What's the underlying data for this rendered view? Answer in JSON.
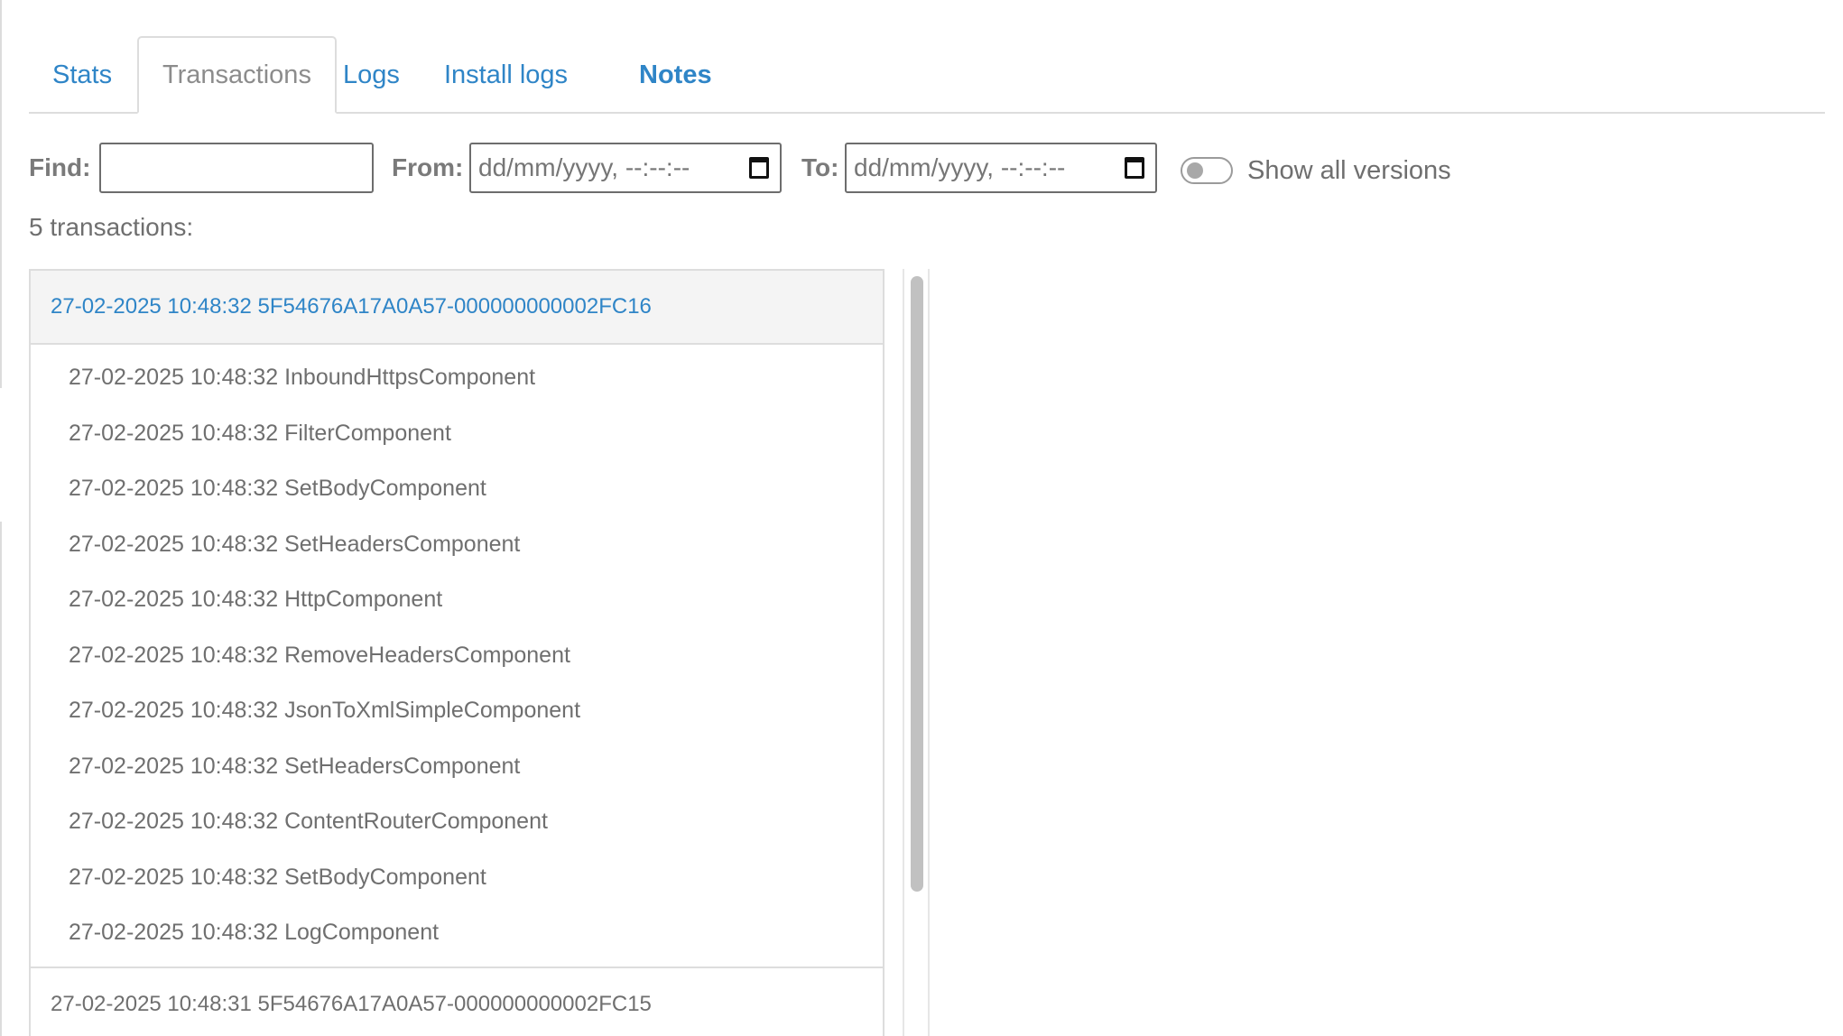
{
  "tabs": [
    {
      "label": "Stats",
      "active": false,
      "bold": false
    },
    {
      "label": "Transactions",
      "active": true,
      "bold": false
    },
    {
      "label": "Logs",
      "active": false,
      "bold": false
    },
    {
      "label": "Install logs",
      "active": false,
      "bold": false
    },
    {
      "label": "Notes",
      "active": false,
      "bold": true
    }
  ],
  "filters": {
    "find_label": "Find:",
    "find_value": "",
    "from_label": "From:",
    "from_placeholder": "dd/mm/yyyy, --:--:--",
    "to_label": "To:",
    "to_placeholder": "dd/mm/yyyy, --:--:--",
    "show_all_versions_label": "Show all versions",
    "show_all_versions_on": false
  },
  "summary": {
    "count_text": "5 transactions:"
  },
  "transactions": [
    {
      "header": "27-02-2025 10:48:32 5F54676A17A0A57-000000000002FC16",
      "expanded": true,
      "components": [
        "27-02-2025 10:48:32 InboundHttpsComponent",
        "27-02-2025 10:48:32 FilterComponent",
        "27-02-2025 10:48:32 SetBodyComponent",
        "27-02-2025 10:48:32 SetHeadersComponent",
        "27-02-2025 10:48:32 HttpComponent",
        "27-02-2025 10:48:32 RemoveHeadersComponent",
        "27-02-2025 10:48:32 JsonToXmlSimpleComponent",
        "27-02-2025 10:48:32 SetHeadersComponent",
        "27-02-2025 10:48:32 ContentRouterComponent",
        "27-02-2025 10:48:32 SetBodyComponent",
        "27-02-2025 10:48:32 LogComponent"
      ]
    },
    {
      "header": "27-02-2025 10:48:31 5F54676A17A0A57-000000000002FC15",
      "expanded": false,
      "components": []
    }
  ],
  "colors": {
    "link": "#2f85c7",
    "muted_text": "#6f6f6f",
    "border": "#dddddd",
    "expanded_header_bg": "#f4f4f4"
  }
}
